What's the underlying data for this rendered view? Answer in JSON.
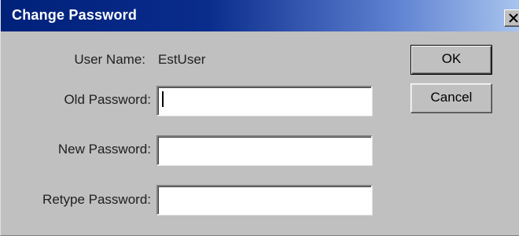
{
  "window": {
    "title": "Change Password",
    "close_icon": "close-x-icon"
  },
  "form": {
    "user_name_label": "User Name:",
    "user_name_value": "EstUser",
    "old_password_label": "Old Password:",
    "old_password_value": "",
    "new_password_label": "New Password:",
    "new_password_value": "",
    "retype_password_label": "Retype Password:",
    "retype_password_value": ""
  },
  "buttons": {
    "ok_label": "OK",
    "cancel_label": "Cancel"
  },
  "colors": {
    "title_bar_start": "#00217a",
    "title_bar_end": "#a8c4ee",
    "dialog_face": "#c0c0c0"
  }
}
